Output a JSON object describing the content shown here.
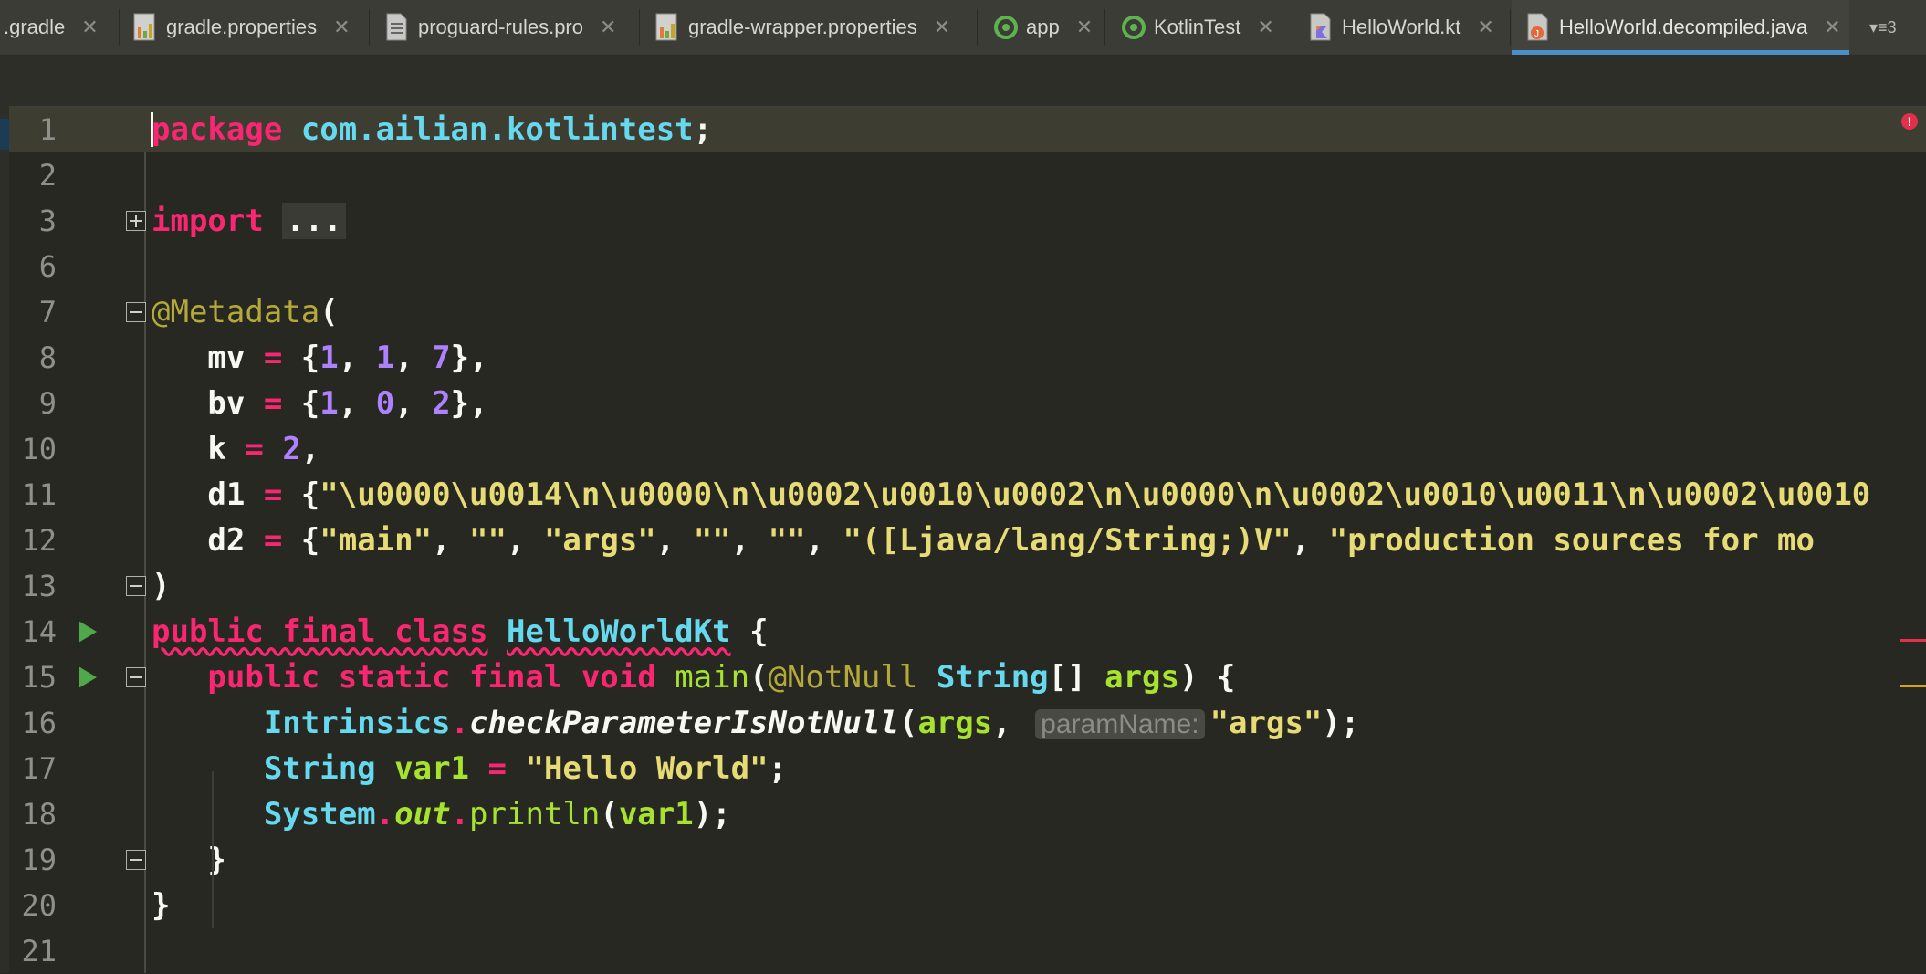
{
  "tabs": [
    {
      "label": ".gradle",
      "icon": "gradle-file-icon"
    },
    {
      "label": "gradle.properties",
      "icon": "properties-file-icon"
    },
    {
      "label": "proguard-rules.pro",
      "icon": "text-file-icon"
    },
    {
      "label": "gradle-wrapper.properties",
      "icon": "properties-file-icon"
    },
    {
      "label": "app",
      "icon": "android-module-icon"
    },
    {
      "label": "KotlinTest",
      "icon": "android-module-icon"
    },
    {
      "label": "HelloWorld.kt",
      "icon": "kotlin-file-icon"
    },
    {
      "label": "HelloWorld.decompiled.java",
      "icon": "java-file-icon",
      "active": true
    }
  ],
  "overflow": {
    "count": "3"
  },
  "colors": {
    "background": "#272822",
    "keyword": "#f92672",
    "type": "#66d9ef",
    "string": "#e6db74",
    "number": "#ae81ff",
    "function": "#a6e22e",
    "annotation": "#b5a93a",
    "active_tab_underline": "#4a90c8"
  },
  "lines": [
    {
      "n": "1",
      "tokens": [
        [
          "kw",
          "package"
        ],
        [
          "pl",
          " "
        ],
        [
          "pk",
          "com.ailian.kotlintest"
        ],
        [
          "pl",
          ";"
        ]
      ]
    },
    {
      "n": "2",
      "tokens": []
    },
    {
      "n": "3",
      "tokens": [
        [
          "kw",
          "import"
        ],
        [
          "pl",
          " "
        ],
        [
          "foldbox",
          "..."
        ]
      ]
    },
    {
      "n": "6",
      "tokens": []
    },
    {
      "n": "7",
      "tokens": [
        [
          "ann",
          "@Metadata"
        ],
        [
          "pl",
          "("
        ]
      ]
    },
    {
      "n": "8",
      "tokens": [
        [
          "pl",
          "   mv "
        ],
        [
          "kw",
          "="
        ],
        [
          "pl",
          " {"
        ],
        [
          "num",
          "1"
        ],
        [
          "pl",
          ", "
        ],
        [
          "num",
          "1"
        ],
        [
          "pl",
          ", "
        ],
        [
          "num",
          "7"
        ],
        [
          "pl",
          "},"
        ]
      ]
    },
    {
      "n": "9",
      "tokens": [
        [
          "pl",
          "   bv "
        ],
        [
          "kw",
          "="
        ],
        [
          "pl",
          " {"
        ],
        [
          "num",
          "1"
        ],
        [
          "pl",
          ", "
        ],
        [
          "num",
          "0"
        ],
        [
          "pl",
          ", "
        ],
        [
          "num",
          "2"
        ],
        [
          "pl",
          "},"
        ]
      ]
    },
    {
      "n": "10",
      "tokens": [
        [
          "pl",
          "   k "
        ],
        [
          "kw",
          "="
        ],
        [
          "pl",
          " "
        ],
        [
          "num",
          "2"
        ],
        [
          "pl",
          ","
        ]
      ]
    },
    {
      "n": "11",
      "tokens": [
        [
          "pl",
          "   d1 "
        ],
        [
          "kw",
          "="
        ],
        [
          "pl",
          " {"
        ],
        [
          "str",
          "\"\\u0000\\u0014\\n\\u0000\\n\\u0002\\u0010\\u0002\\n\\u0000\\n\\u0002\\u0010\\u0011\\n\\u0002\\u0010"
        ]
      ]
    },
    {
      "n": "12",
      "tokens": [
        [
          "pl",
          "   d2 "
        ],
        [
          "kw",
          "="
        ],
        [
          "pl",
          " {"
        ],
        [
          "str",
          "\"main\""
        ],
        [
          "pl",
          ", "
        ],
        [
          "str",
          "\"\""
        ],
        [
          "pl",
          ", "
        ],
        [
          "str",
          "\"args\""
        ],
        [
          "pl",
          ", "
        ],
        [
          "str",
          "\"\""
        ],
        [
          "pl",
          ", "
        ],
        [
          "str",
          "\"\""
        ],
        [
          "pl",
          ", "
        ],
        [
          "str",
          "\"([Ljava/lang/String;)V\""
        ],
        [
          "pl",
          ", "
        ],
        [
          "str",
          "\"production sources for mo"
        ]
      ]
    },
    {
      "n": "13",
      "tokens": [
        [
          "pl",
          ")"
        ]
      ]
    },
    {
      "n": "14",
      "tokens": [
        [
          "kwsq",
          "public final class"
        ],
        [
          "pl",
          " "
        ],
        [
          "clssq",
          "HelloWorldKt"
        ],
        [
          "pl",
          " {"
        ]
      ]
    },
    {
      "n": "15",
      "tokens": [
        [
          "pl",
          "   "
        ],
        [
          "kw",
          "public static final void"
        ],
        [
          "pl",
          " "
        ],
        [
          "fn",
          "main"
        ],
        [
          "pl",
          "("
        ],
        [
          "ann",
          "@NotNull"
        ],
        [
          "pl",
          " "
        ],
        [
          "cls",
          "String"
        ],
        [
          "pl",
          "[] "
        ],
        [
          "par",
          "args"
        ],
        [
          "pl",
          ") {"
        ]
      ]
    },
    {
      "n": "16",
      "tokens": [
        [
          "pl",
          "      "
        ],
        [
          "cls",
          "Intrinsics"
        ],
        [
          "kw",
          "."
        ],
        [
          "it",
          "checkParameterIsNotNull"
        ],
        [
          "pl",
          "("
        ],
        [
          "par",
          "args"
        ],
        [
          "pl",
          ", "
        ],
        [
          "hint",
          "paramName:"
        ],
        [
          "str",
          "\"args\""
        ],
        [
          "pl",
          ");"
        ]
      ]
    },
    {
      "n": "17",
      "tokens": [
        [
          "pl",
          "      "
        ],
        [
          "cls",
          "String"
        ],
        [
          "pl",
          " "
        ],
        [
          "par",
          "var1"
        ],
        [
          "pl",
          " "
        ],
        [
          "kw",
          "="
        ],
        [
          "pl",
          " "
        ],
        [
          "str",
          "\"Hello World\""
        ],
        [
          "pl",
          ";"
        ]
      ]
    },
    {
      "n": "18",
      "tokens": [
        [
          "pl",
          "      "
        ],
        [
          "cls",
          "System"
        ],
        [
          "kw",
          "."
        ],
        [
          "itg",
          "out"
        ],
        [
          "kw",
          "."
        ],
        [
          "fn",
          "println"
        ],
        [
          "pl",
          "("
        ],
        [
          "par",
          "var1"
        ],
        [
          "pl",
          ");"
        ]
      ]
    },
    {
      "n": "19",
      "tokens": [
        [
          "pl",
          "   }"
        ]
      ]
    },
    {
      "n": "20",
      "tokens": [
        [
          "pl",
          "}"
        ]
      ]
    },
    {
      "n": "21",
      "tokens": []
    }
  ]
}
